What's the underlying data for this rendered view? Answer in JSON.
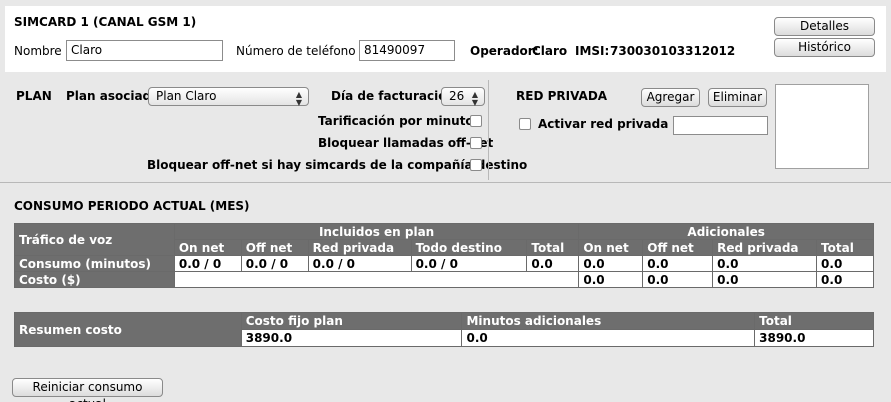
{
  "sim": {
    "title": "SIMCARD 1 (CANAL GSM 1)",
    "name_label": "Nombre",
    "name_value": "Claro",
    "phone_label": "Número de teléfono",
    "phone_value": "81490097",
    "operator_label": "Operador:",
    "operator_value": "Claro",
    "imsi_label": "IMSI:",
    "imsi_value": "730030103312012",
    "details_button": "Detalles",
    "history_button": "Histórico"
  },
  "plan": {
    "heading": "PLAN",
    "assoc_label": "Plan asociado",
    "assoc_value": "Plan Claro",
    "billing_label": "Día de facturación",
    "billing_value": "26",
    "opt_minutes": "Tarificación por minutos",
    "opt_block_offnet": "Bloquear llamadas off-net",
    "opt_block_offnet_dest": "Bloquear off-net si hay simcards de la compañía destino"
  },
  "private_net": {
    "heading": "RED PRIVADA",
    "add_button": "Agregar",
    "remove_button": "Eliminar",
    "activate_label": "Activar red privada",
    "input_value": ""
  },
  "consumption": {
    "heading": "CONSUMO PERIODO ACTUAL (MES)",
    "voice_label": "Tráfico de voz",
    "included_label": "Incluidos en plan",
    "additional_label": "Adicionales",
    "included_cols": [
      "On net",
      "Off net",
      "Red privada",
      "Todo destino",
      "Total"
    ],
    "additional_cols": [
      "On net",
      "Off net",
      "Red privada",
      "Total"
    ],
    "rows": [
      {
        "label": "Consumo (minutos)",
        "included": [
          "0.0 / 0",
          "0.0 / 0",
          "0.0 / 0",
          "0.0 / 0",
          "0.0"
        ],
        "additional": [
          "0.0",
          "0.0",
          "0.0",
          "0.0"
        ]
      },
      {
        "label": "Costo ($)",
        "included": [
          "",
          "",
          "",
          "",
          ""
        ],
        "additional": [
          "0.0",
          "0.0",
          "0.0",
          "0.0"
        ]
      }
    ]
  },
  "summary": {
    "label": "Resumen costo",
    "cols": [
      "Costo fijo plan",
      "Minutos adicionales",
      "Total"
    ],
    "values": [
      "3890.0",
      "0.0",
      "3890.0"
    ]
  },
  "reset_button": "Reiniciar consumo actual"
}
